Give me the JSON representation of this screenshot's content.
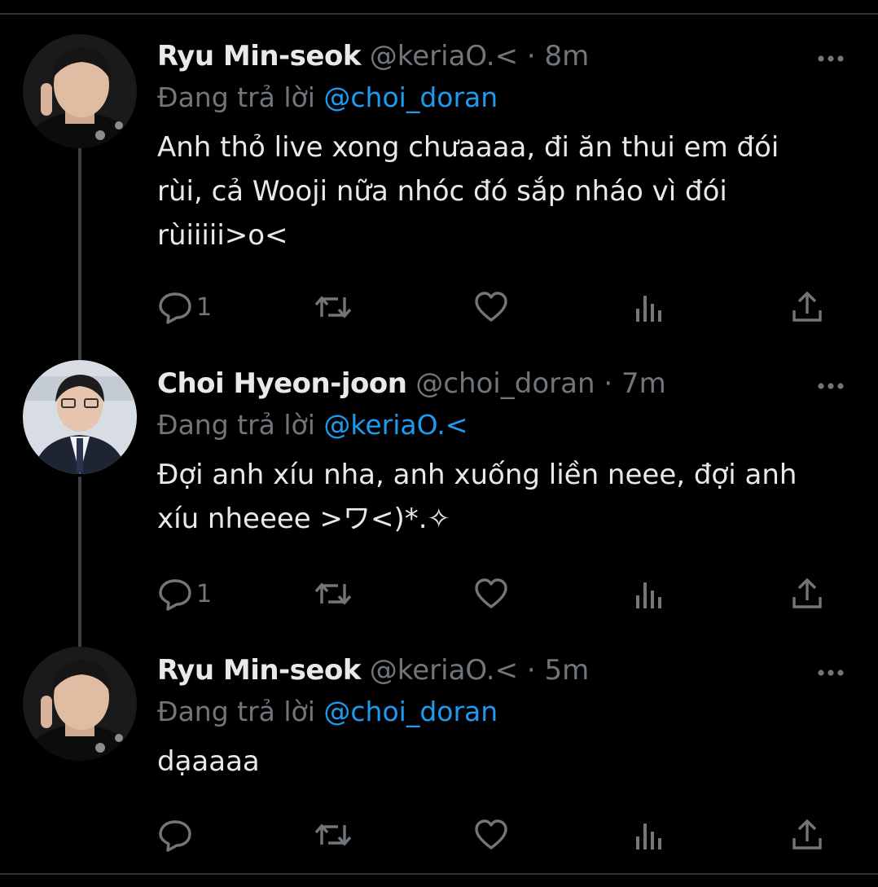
{
  "colors": {
    "background": "#000000",
    "text": "#e7e9ea",
    "muted": "#71767b",
    "link": "#1d9bf0"
  },
  "tweets": [
    {
      "name": "Ryu Min-seok",
      "handle": "@keriaO.<",
      "separator": "·",
      "time": "8m",
      "reply_prefix": "Đang trả lời",
      "reply_to": "@choi_doran",
      "lines": [
        "Anh thỏ live xong chưaaaa, đi ăn thui em đói",
        "rùi, cả Wooji nữa nhóc đó sắp nháo vì đói",
        "rùiiiii>o<"
      ],
      "reply_count": "1",
      "icons": [
        "reply-icon",
        "retweet-icon",
        "like-icon",
        "views-icon",
        "share-icon"
      ]
    },
    {
      "name": "Choi Hyeon-joon",
      "handle": "@choi_doran",
      "separator": "·",
      "time": "7m",
      "reply_prefix": "Đang trả lời",
      "reply_to": "@keriaO.<",
      "lines": [
        "Đợi anh xíu nha, anh xuống liền neee, đợi anh",
        "xíu nheeee >ワ<)*.✧"
      ],
      "reply_count": "1",
      "icons": [
        "reply-icon",
        "retweet-icon",
        "like-icon",
        "views-icon",
        "share-icon"
      ]
    },
    {
      "name": "Ryu Min-seok",
      "handle": "@keriaO.<",
      "separator": "·",
      "time": "5m",
      "reply_prefix": "Đang trả lời",
      "reply_to": "@choi_doran",
      "lines": [
        "dạaaaa"
      ],
      "reply_count": "",
      "icons": [
        "reply-icon",
        "retweet-icon",
        "like-icon",
        "views-icon",
        "share-icon"
      ]
    }
  ]
}
